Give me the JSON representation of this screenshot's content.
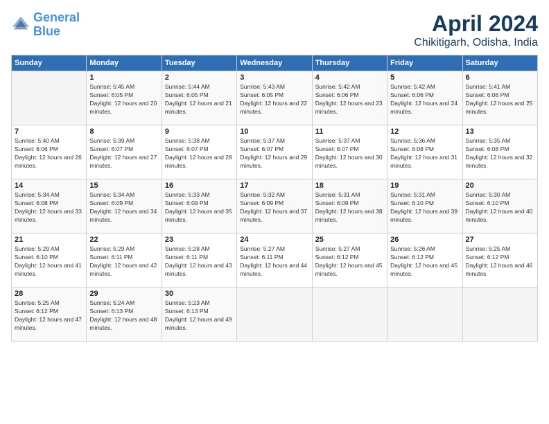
{
  "logo": {
    "line1": "General",
    "line2": "Blue"
  },
  "title": "April 2024",
  "location": "Chikitigarh, Odisha, India",
  "weekdays": [
    "Sunday",
    "Monday",
    "Tuesday",
    "Wednesday",
    "Thursday",
    "Friday",
    "Saturday"
  ],
  "weeks": [
    [
      {
        "day": "",
        "sunrise": "",
        "sunset": "",
        "daylight": ""
      },
      {
        "day": "1",
        "sunrise": "Sunrise: 5:45 AM",
        "sunset": "Sunset: 6:05 PM",
        "daylight": "Daylight: 12 hours and 20 minutes."
      },
      {
        "day": "2",
        "sunrise": "Sunrise: 5:44 AM",
        "sunset": "Sunset: 6:05 PM",
        "daylight": "Daylight: 12 hours and 21 minutes."
      },
      {
        "day": "3",
        "sunrise": "Sunrise: 5:43 AM",
        "sunset": "Sunset: 6:05 PM",
        "daylight": "Daylight: 12 hours and 22 minutes."
      },
      {
        "day": "4",
        "sunrise": "Sunrise: 5:42 AM",
        "sunset": "Sunset: 6:06 PM",
        "daylight": "Daylight: 12 hours and 23 minutes."
      },
      {
        "day": "5",
        "sunrise": "Sunrise: 5:42 AM",
        "sunset": "Sunset: 6:06 PM",
        "daylight": "Daylight: 12 hours and 24 minutes."
      },
      {
        "day": "6",
        "sunrise": "Sunrise: 5:41 AM",
        "sunset": "Sunset: 6:06 PM",
        "daylight": "Daylight: 12 hours and 25 minutes."
      }
    ],
    [
      {
        "day": "7",
        "sunrise": "Sunrise: 5:40 AM",
        "sunset": "Sunset: 6:06 PM",
        "daylight": "Daylight: 12 hours and 26 minutes."
      },
      {
        "day": "8",
        "sunrise": "Sunrise: 5:39 AM",
        "sunset": "Sunset: 6:07 PM",
        "daylight": "Daylight: 12 hours and 27 minutes."
      },
      {
        "day": "9",
        "sunrise": "Sunrise: 5:38 AM",
        "sunset": "Sunset: 6:07 PM",
        "daylight": "Daylight: 12 hours and 28 minutes."
      },
      {
        "day": "10",
        "sunrise": "Sunrise: 5:37 AM",
        "sunset": "Sunset: 6:07 PM",
        "daylight": "Daylight: 12 hours and 29 minutes."
      },
      {
        "day": "11",
        "sunrise": "Sunrise: 5:37 AM",
        "sunset": "Sunset: 6:07 PM",
        "daylight": "Daylight: 12 hours and 30 minutes."
      },
      {
        "day": "12",
        "sunrise": "Sunrise: 5:36 AM",
        "sunset": "Sunset: 6:08 PM",
        "daylight": "Daylight: 12 hours and 31 minutes."
      },
      {
        "day": "13",
        "sunrise": "Sunrise: 5:35 AM",
        "sunset": "Sunset: 6:08 PM",
        "daylight": "Daylight: 12 hours and 32 minutes."
      }
    ],
    [
      {
        "day": "14",
        "sunrise": "Sunrise: 5:34 AM",
        "sunset": "Sunset: 6:08 PM",
        "daylight": "Daylight: 12 hours and 33 minutes."
      },
      {
        "day": "15",
        "sunrise": "Sunrise: 5:34 AM",
        "sunset": "Sunset: 6:09 PM",
        "daylight": "Daylight: 12 hours and 34 minutes."
      },
      {
        "day": "16",
        "sunrise": "Sunrise: 5:33 AM",
        "sunset": "Sunset: 6:09 PM",
        "daylight": "Daylight: 12 hours and 35 minutes."
      },
      {
        "day": "17",
        "sunrise": "Sunrise: 5:32 AM",
        "sunset": "Sunset: 6:09 PM",
        "daylight": "Daylight: 12 hours and 37 minutes."
      },
      {
        "day": "18",
        "sunrise": "Sunrise: 5:31 AM",
        "sunset": "Sunset: 6:09 PM",
        "daylight": "Daylight: 12 hours and 38 minutes."
      },
      {
        "day": "19",
        "sunrise": "Sunrise: 5:31 AM",
        "sunset": "Sunset: 6:10 PM",
        "daylight": "Daylight: 12 hours and 39 minutes."
      },
      {
        "day": "20",
        "sunrise": "Sunrise: 5:30 AM",
        "sunset": "Sunset: 6:10 PM",
        "daylight": "Daylight: 12 hours and 40 minutes."
      }
    ],
    [
      {
        "day": "21",
        "sunrise": "Sunrise: 5:29 AM",
        "sunset": "Sunset: 6:10 PM",
        "daylight": "Daylight: 12 hours and 41 minutes."
      },
      {
        "day": "22",
        "sunrise": "Sunrise: 5:29 AM",
        "sunset": "Sunset: 6:11 PM",
        "daylight": "Daylight: 12 hours and 42 minutes."
      },
      {
        "day": "23",
        "sunrise": "Sunrise: 5:28 AM",
        "sunset": "Sunset: 6:11 PM",
        "daylight": "Daylight: 12 hours and 43 minutes."
      },
      {
        "day": "24",
        "sunrise": "Sunrise: 5:27 AM",
        "sunset": "Sunset: 6:11 PM",
        "daylight": "Daylight: 12 hours and 44 minutes."
      },
      {
        "day": "25",
        "sunrise": "Sunrise: 5:27 AM",
        "sunset": "Sunset: 6:12 PM",
        "daylight": "Daylight: 12 hours and 45 minutes."
      },
      {
        "day": "26",
        "sunrise": "Sunrise: 5:26 AM",
        "sunset": "Sunset: 6:12 PM",
        "daylight": "Daylight: 12 hours and 45 minutes."
      },
      {
        "day": "27",
        "sunrise": "Sunrise: 5:25 AM",
        "sunset": "Sunset: 6:12 PM",
        "daylight": "Daylight: 12 hours and 46 minutes."
      }
    ],
    [
      {
        "day": "28",
        "sunrise": "Sunrise: 5:25 AM",
        "sunset": "Sunset: 6:12 PM",
        "daylight": "Daylight: 12 hours and 47 minutes."
      },
      {
        "day": "29",
        "sunrise": "Sunrise: 5:24 AM",
        "sunset": "Sunset: 6:13 PM",
        "daylight": "Daylight: 12 hours and 48 minutes."
      },
      {
        "day": "30",
        "sunrise": "Sunrise: 5:23 AM",
        "sunset": "Sunset: 6:13 PM",
        "daylight": "Daylight: 12 hours and 49 minutes."
      },
      {
        "day": "",
        "sunrise": "",
        "sunset": "",
        "daylight": ""
      },
      {
        "day": "",
        "sunrise": "",
        "sunset": "",
        "daylight": ""
      },
      {
        "day": "",
        "sunrise": "",
        "sunset": "",
        "daylight": ""
      },
      {
        "day": "",
        "sunrise": "",
        "sunset": "",
        "daylight": ""
      }
    ]
  ]
}
